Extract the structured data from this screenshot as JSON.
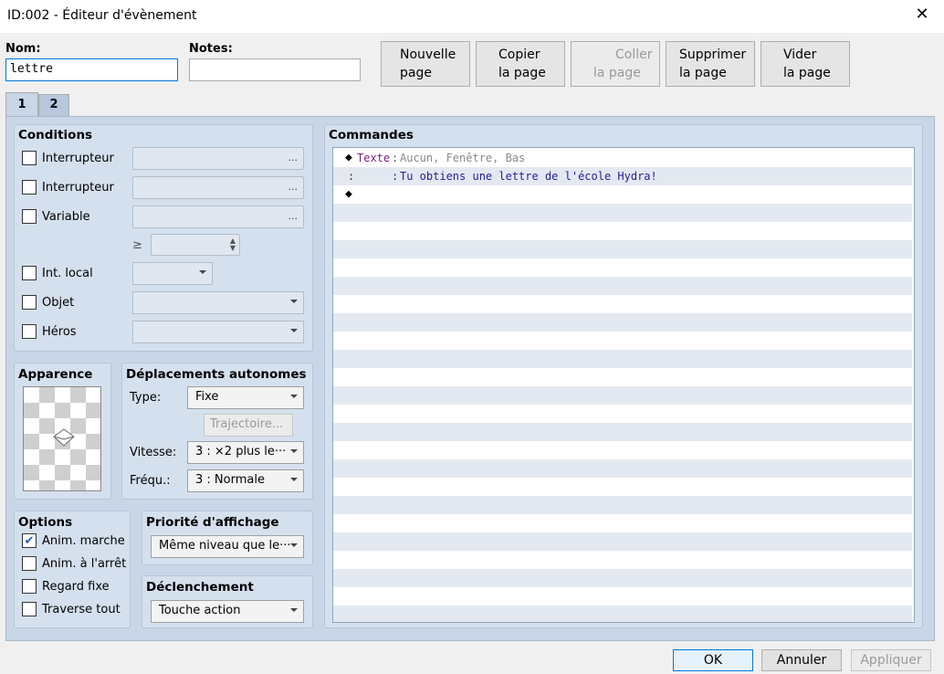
{
  "window": {
    "title": "ID:002 - Éditeur d'évènement",
    "close_glyph": "✕"
  },
  "fields": {
    "name_label": "Nom:",
    "name_value": "lettre",
    "notes_label": "Notes:",
    "notes_value": ""
  },
  "page_buttons": [
    {
      "line1": "Nouvelle",
      "line2": "page",
      "enabled": true
    },
    {
      "line1": "Copier",
      "line2": "la page",
      "enabled": true
    },
    {
      "line1": "Coller",
      "line2": "la page",
      "enabled": false
    },
    {
      "line1": "Supprimer",
      "line2": "la page",
      "enabled": true
    },
    {
      "line1": "Vider",
      "line2": "la page",
      "enabled": true
    }
  ],
  "tabs": [
    "1",
    "2"
  ],
  "conditions": {
    "title": "Conditions",
    "switch1": "Interrupteur",
    "switch2": "Interrupteur",
    "variable": "Variable",
    "gte": "≥",
    "self_switch": "Int. local",
    "item": "Objet",
    "actor": "Héros",
    "dots": "..."
  },
  "appearance": {
    "title": "Apparence"
  },
  "autonomous": {
    "title": "Déplacements autonomes",
    "type_label": "Type:",
    "type_value": "Fixe",
    "route_button": "Trajectoire...",
    "speed_label": "Vitesse:",
    "speed_value": "3 : ×2 plus le···",
    "freq_label": "Fréqu.:",
    "freq_value": "3 : Normale"
  },
  "options": {
    "title": "Options",
    "items": [
      {
        "label": "Anim. marche",
        "checked": true
      },
      {
        "label": "Anim. à l'arrêt",
        "checked": false
      },
      {
        "label": "Regard fixe",
        "checked": false
      },
      {
        "label": "Traverse tout",
        "checked": false
      }
    ]
  },
  "priority": {
    "title": "Priorité d'affichage",
    "value": "Même niveau que le···"
  },
  "trigger": {
    "title": "Déclenchement",
    "value": "Touche action"
  },
  "commands": {
    "title": "Commandes",
    "line1_marker": "◆",
    "line1_cmd": "Texte",
    "line1_sep": ":",
    "line1_args": "Aucun, Fenêtre, Bas",
    "line2_marker": ":",
    "line2_sep": ":",
    "line2_text": "Tu obtiens une lettre de l'école Hydra!",
    "line3_marker": "◆"
  },
  "footer": {
    "ok": "OK",
    "cancel": "Annuler",
    "apply": "Appliquer"
  },
  "colors": {
    "cmd_name": "#7a1d7a",
    "cmd_args": "#8a8a8a",
    "cmd_text": "#1f1f9a"
  }
}
